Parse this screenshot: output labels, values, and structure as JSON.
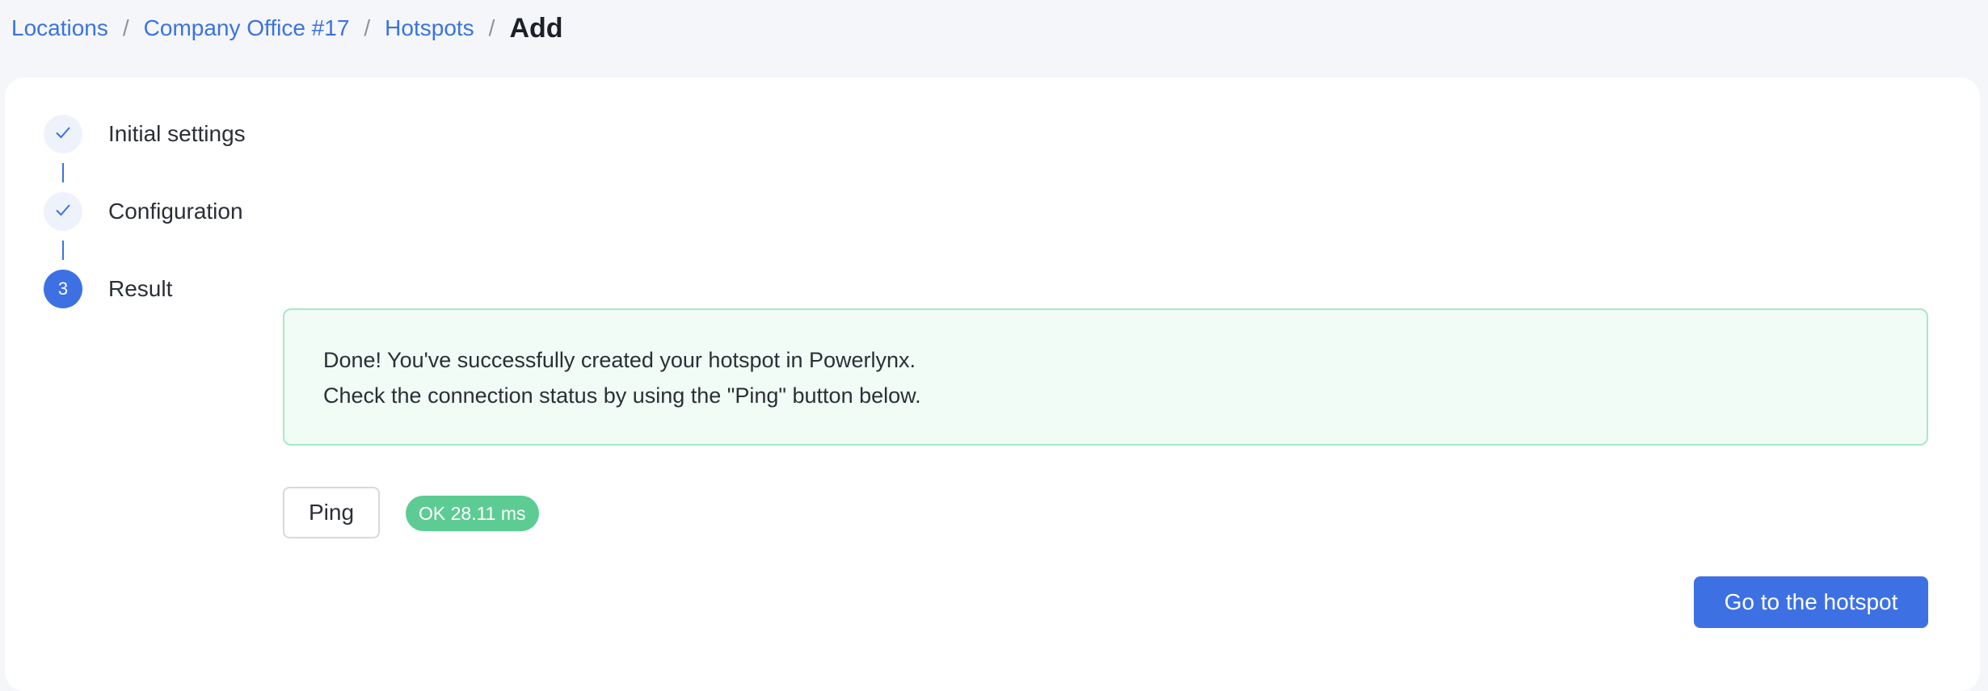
{
  "breadcrumb": {
    "items": [
      "Locations",
      "Company Office #17",
      "Hotspots"
    ],
    "separator": "/",
    "current": "Add"
  },
  "stepper": {
    "steps": [
      {
        "label": "Initial settings",
        "status": "completed",
        "icon": "check-icon"
      },
      {
        "label": "Configuration",
        "status": "completed",
        "icon": "check-icon"
      },
      {
        "label": "Result",
        "status": "active",
        "number": "3"
      }
    ]
  },
  "alert": {
    "line1": "Done! You've successfully created your hotspot in Powerlynx.",
    "line2": "Check the connection status by using the \"Ping\" button below."
  },
  "ping": {
    "button_label": "Ping",
    "status": "OK 28.11 ms"
  },
  "actions": {
    "go_to_hotspot_label": "Go to the hotspot"
  },
  "colors": {
    "accent": "#3d71e3",
    "link": "#3b73e0",
    "success_bg": "#f0fcf5",
    "success_border": "#a8e8c9",
    "status_ok": "#5dcc94"
  }
}
